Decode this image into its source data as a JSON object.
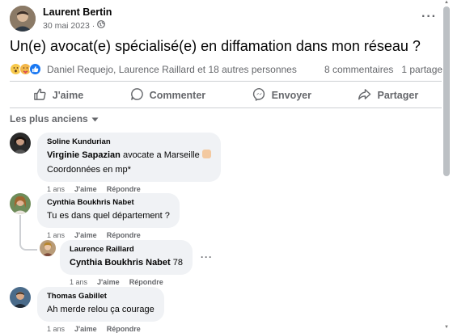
{
  "post": {
    "author": "Laurent Bertin",
    "date": "30 mai 2023",
    "dot": "·",
    "more": "···",
    "text": "Un(e) avocat(e) spécialisé(e) en diffamation dans mon réseau ?"
  },
  "reactions": {
    "icons": [
      "wow-icon",
      "care-icon",
      "like-icon"
    ],
    "reactors": "Daniel Requejo, Laurence Raillard et 18 autres personnes",
    "comments_count": "8 commentaires",
    "shares_count": "1 partage"
  },
  "actions": {
    "like": "J'aime",
    "comment": "Commenter",
    "send": "Envoyer",
    "share": "Partager"
  },
  "sort": {
    "label": "Les plus anciens"
  },
  "comments": [
    {
      "author": "Soline Kundurian",
      "mention": "Virginie Sapazian",
      "text_after": " avocate a Marseille",
      "line2": "Coordonnées en mp*",
      "time": "1 ans",
      "like": "J'aime",
      "reply": "Répondre"
    },
    {
      "author": "Cynthia Boukhris Nabet",
      "text": "Tu es dans quel département ?",
      "time": "1 ans",
      "like": "J'aime",
      "reply": "Répondre"
    },
    {
      "author": "Laurence Raillard",
      "mention": "Cynthia Boukhris Nabet",
      "text_after": " 78",
      "more": "···",
      "time": "1 ans",
      "like": "J'aime",
      "reply": "Répondre"
    },
    {
      "author": "Thomas Gabillet",
      "text": "Ah merde relou ça courage",
      "time": "1 ans",
      "like": "J'aime",
      "reply": "Répondre"
    }
  ],
  "colors": {
    "accent": "#1877f2",
    "bubble": "#f0f2f5",
    "secondary_text": "#65676b"
  }
}
